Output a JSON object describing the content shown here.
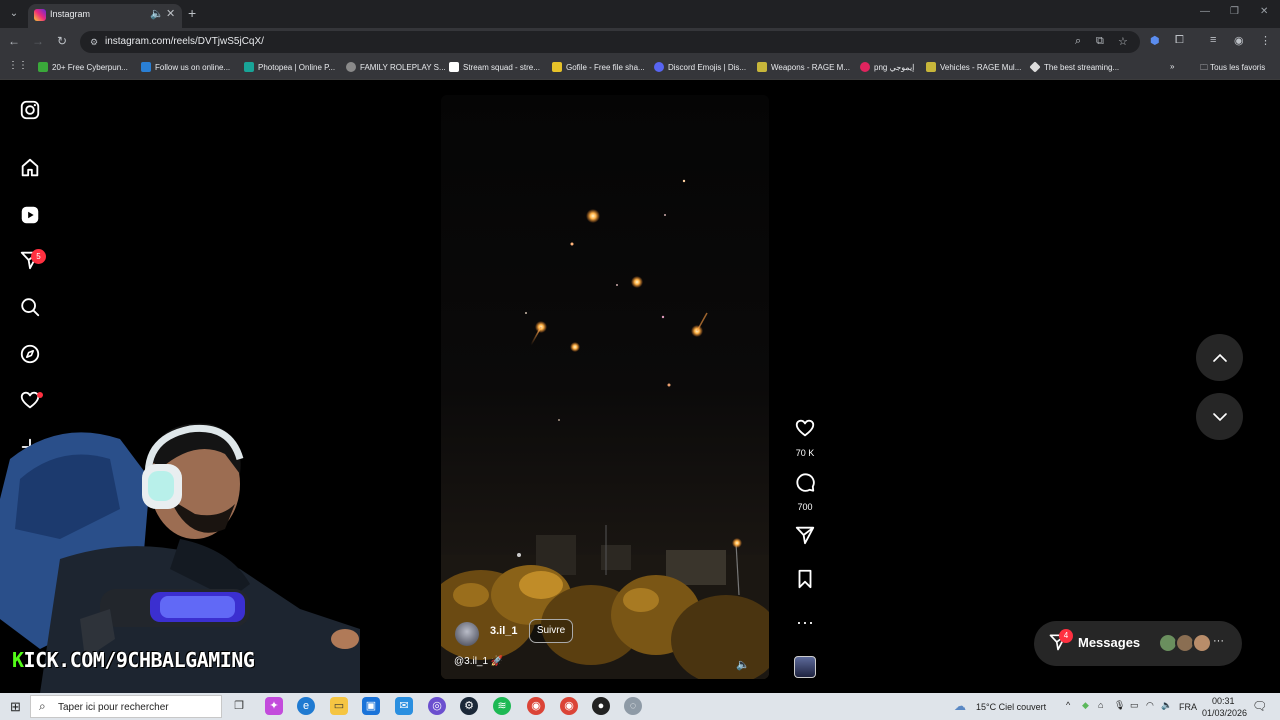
{
  "browser": {
    "tab": {
      "title": "Instagram"
    },
    "url": "instagram.com/reels/DVTjwS5jCqX/",
    "bookmarks": [
      {
        "label": "20+ Free Cyberpun...",
        "color": "#3aa83a"
      },
      {
        "label": "Follow us on online...",
        "color": "#2a7fd4"
      },
      {
        "label": "Photopea | Online P...",
        "color": "#18a497"
      },
      {
        "label": "FAMILY ROLEPLAY S...",
        "color": "#8a8a8a"
      },
      {
        "label": "Stream squad - stre...",
        "color": "#ffffff"
      },
      {
        "label": "Gofile - Free file sha...",
        "color": "#e6c229"
      },
      {
        "label": "Discord Emojis | Dis...",
        "color": "#5865f2"
      },
      {
        "label": "Weapons - RAGE M...",
        "color": "#c7b63a"
      },
      {
        "label": "png إيموجي",
        "color": "#e0245e"
      },
      {
        "label": "Vehicles - RAGE Mul...",
        "color": "#c7b63a"
      },
      {
        "label": "The best streaming...",
        "color": "#dddddd"
      }
    ],
    "all_favorites": "Tous les favoris"
  },
  "sidebar": {
    "notifications_count": "5"
  },
  "reel": {
    "username": "3.il_1",
    "follow_label": "Suivre",
    "audio_label": "@3.il_1",
    "likes": "70 K",
    "comments": "700"
  },
  "messages": {
    "label": "Messages",
    "count": "4"
  },
  "overlay": {
    "kick_prefix": "K",
    "kick_rest": "ICK.COM/9CHBALGAMING"
  },
  "taskbar": {
    "search_placeholder": "Taper ici pour rechercher",
    "weather": "15°C  Ciel couvert",
    "language": "FRA",
    "time": "00:31",
    "date": "01/03/2026"
  },
  "colors": {
    "accent_red": "#ff3040",
    "kick_green": "#53fc18"
  }
}
